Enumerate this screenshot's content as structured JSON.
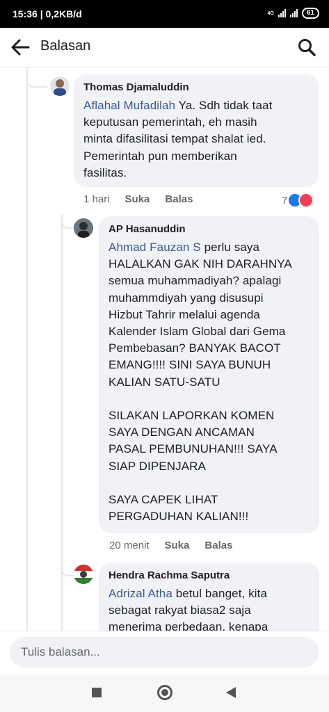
{
  "status_bar": {
    "time": "15:36 | 0,2KB/d",
    "network": "4G",
    "battery": "61"
  },
  "header": {
    "title": "Balasan",
    "back_icon": "arrow-left-icon",
    "search_icon": "search-icon"
  },
  "comments": [
    {
      "author": "Thomas Djamaluddin",
      "mention": "Aflahal Mufadilah",
      "lines": [
        "Ya. Sdh tidak taat",
        "keputusan pemerintah, eh masih",
        "minta difasilitasi tempat shalat ied.",
        "Pemerintah pun memberikan",
        "fasilitas."
      ],
      "time": "1 hari",
      "like_label": "Suka",
      "reply_label": "Balas",
      "reaction_count": "7"
    },
    {
      "author": "AP Hasanuddin",
      "mention": "Ahmad Fauzan S",
      "lines": [
        "perlu saya",
        "HALALKAN GAK NIH DARAHNYA",
        "semua muhammadiyah? apalagi",
        "muhammdiyah yang disusupi",
        "Hizbut Tahrir melalui agenda",
        "Kalender Islam Global dari Gema",
        "Pembebasan? BANYAK BACOT",
        "EMANG!!!! SINI SAYA BUNUH",
        "KALIAN SATU-SATU",
        "",
        "SILAKAN LAPORKAN KOMEN",
        "SAYA DENGAN ANCAMAN",
        "PASAL PEMBUNUHAN!!! SAYA",
        "SIAP DIPENJARA",
        "",
        "SAYA CAPEK LIHAT",
        "PERGADUHAN KALIAN!!!"
      ],
      "time": "20 menit",
      "like_label": "Suka",
      "reply_label": "Balas"
    },
    {
      "author": "Hendra Rachma Saputra",
      "mention": "Adrizal Atha",
      "lines": [
        "betul banget, kita",
        "sebagat rakyat biasa2 saja",
        "menerima perbedaan, kenapa"
      ]
    }
  ],
  "composer": {
    "placeholder": "Tulis balasan..."
  },
  "nav": {
    "recents_icon": "square-icon",
    "home_icon": "circle-icon",
    "back_icon": "triangle-back-icon"
  },
  "colors": {
    "mention": "#385898",
    "bubble": "#f0f2f5",
    "like": "#1877f2",
    "love": "#f33e58"
  }
}
